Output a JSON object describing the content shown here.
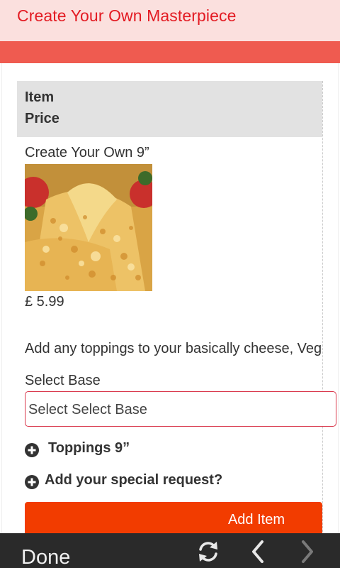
{
  "header": {
    "title": "Create Your Own Masterpiece"
  },
  "table": {
    "headers": [
      "Item",
      "Price"
    ]
  },
  "item": {
    "name": "Create Your Own 9”",
    "image": "pizza-photo",
    "price": "£ 5.99",
    "description": "Add any toppings to your basically cheese, Veg"
  },
  "form": {
    "base_label": "Select Base",
    "base_value": "Select Select Base",
    "toppings_label": "Toppings 9”",
    "special_request_label": "Add your special request?",
    "add_button_label": "Add Item"
  },
  "bottom_bar": {
    "done_label": "Done",
    "icons": [
      "refresh-icon",
      "back-chevron-icon",
      "forward-chevron-icon"
    ]
  },
  "colors": {
    "accent": "#e31b23",
    "title_bg": "#fbe0de",
    "red_bar": "#ef5b50",
    "button": "#f23c00",
    "bottom_bar": "#2a2a2a"
  }
}
